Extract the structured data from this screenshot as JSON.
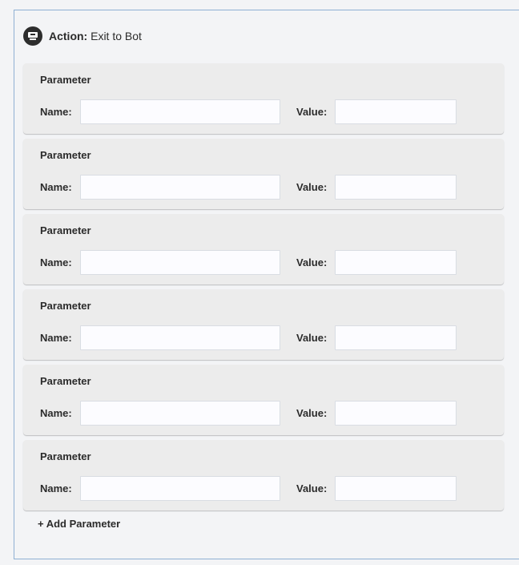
{
  "action": {
    "label": "Action:",
    "name": "Exit to Bot",
    "icon": "bot-exit-icon"
  },
  "parameters": [
    {
      "title": "Parameter",
      "name_label": "Name:",
      "value_label": "Value:",
      "name_value": "",
      "value_value": ""
    },
    {
      "title": "Parameter",
      "name_label": "Name:",
      "value_label": "Value:",
      "name_value": "",
      "value_value": ""
    },
    {
      "title": "Parameter",
      "name_label": "Name:",
      "value_label": "Value:",
      "name_value": "",
      "value_value": ""
    },
    {
      "title": "Parameter",
      "name_label": "Name:",
      "value_label": "Value:",
      "name_value": "",
      "value_value": ""
    },
    {
      "title": "Parameter",
      "name_label": "Name:",
      "value_label": "Value:",
      "name_value": "",
      "value_value": ""
    },
    {
      "title": "Parameter",
      "name_label": "Name:",
      "value_label": "Value:",
      "name_value": "",
      "value_value": ""
    }
  ],
  "add_parameter_label": "+ Add Parameter",
  "colors": {
    "panel_border": "#8fb0d4",
    "card_background": "#ececec",
    "icon_background": "#2d2d2d"
  }
}
